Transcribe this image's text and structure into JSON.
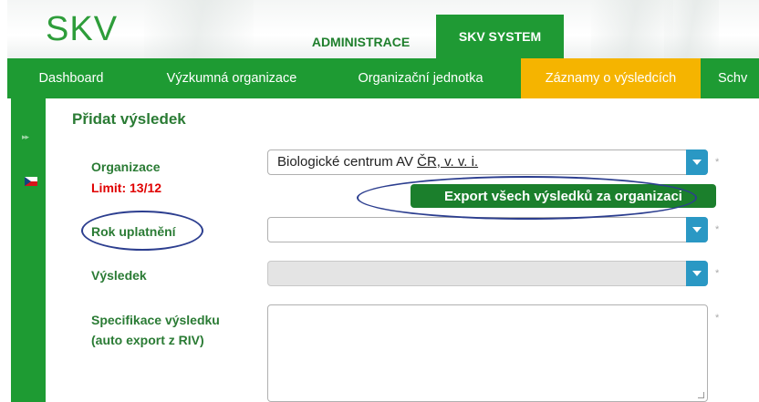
{
  "header": {
    "logo": "SKV",
    "tabs": [
      {
        "label": "ADMINISTRACE",
        "active": false
      },
      {
        "label": "SKV SYSTEM",
        "active": true
      }
    ]
  },
  "nav": {
    "items": [
      {
        "label": "Dashboard",
        "active": false
      },
      {
        "label": "Výzkumná organizace",
        "active": false
      },
      {
        "label": "Organizační jednotka",
        "active": false
      },
      {
        "label": "Záznamy o výsledcích",
        "active": true
      },
      {
        "label": "Schv",
        "active": false
      }
    ]
  },
  "sidebar": {
    "expand_icon": "double-chevron-right-icon",
    "flag_icon": "czech-flag-icon",
    "expand_glyph": "▸▸"
  },
  "form": {
    "title": "Přidat výsledek",
    "organizace": {
      "label": "Organizace",
      "limit": "Limit: 13/12",
      "value_prefix": "Biologické centrum AV ",
      "value_underlined": "ČR, v. v. i.",
      "required_mark": "*"
    },
    "export_button": "Export všech výsledků za organizaci",
    "rok": {
      "label": "Rok uplatnění",
      "value": "",
      "required_mark": "*"
    },
    "vysledek": {
      "label": "Výsledek",
      "value": "",
      "required_mark": "*"
    },
    "specifikace": {
      "label_line1": "Specifikace výsledku",
      "label_line2": "(auto export z RIV)",
      "value": "",
      "required_mark": "*"
    }
  },
  "colors": {
    "brand_green": "#1e9b33",
    "active_tab": "#f5b400",
    "dropdown_button": "#2a98c4",
    "limit_red": "#e00000",
    "annotation_ellipse": "#2c3e8f"
  }
}
